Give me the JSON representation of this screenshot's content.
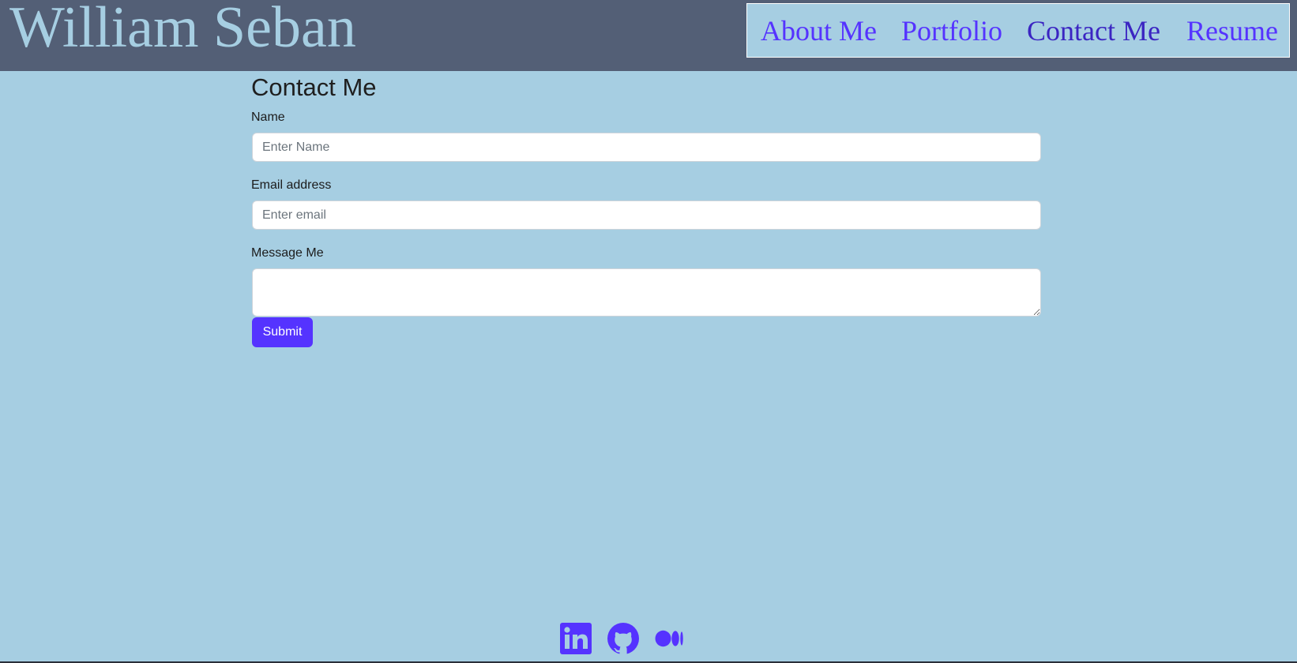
{
  "header": {
    "site_title": "William Seban",
    "nav": [
      {
        "label": "About Me",
        "active": false
      },
      {
        "label": "Portfolio",
        "active": false
      },
      {
        "label": "Contact Me",
        "active": true
      },
      {
        "label": "Resume",
        "active": false
      }
    ]
  },
  "contact": {
    "heading": "Contact Me",
    "name_label": "Name",
    "name_placeholder": "Enter Name",
    "name_value": "",
    "email_label": "Email address",
    "email_placeholder": "Enter email",
    "email_value": "",
    "message_label": "Message Me",
    "message_value": "",
    "submit_label": "Submit"
  },
  "footer": {
    "icons": [
      "linkedin-icon",
      "github-icon",
      "medium-icon"
    ]
  },
  "colors": {
    "background": "#a6cee2",
    "header": "#535f76",
    "accent": "#5533ff",
    "nav_active": "#3b25c2"
  }
}
